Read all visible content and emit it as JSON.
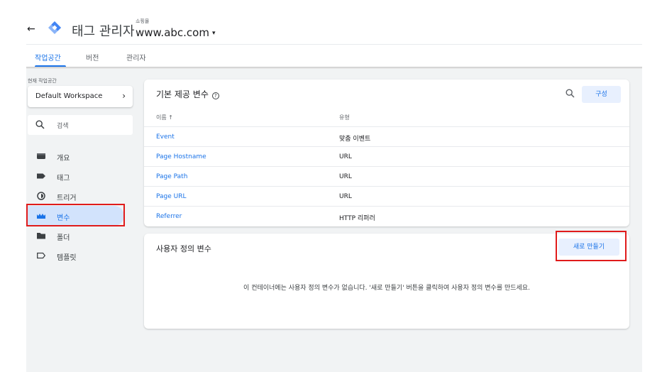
{
  "header": {
    "back_label": "←",
    "app_title": "태그 관리자",
    "account_label": "쇼핑몰",
    "container_name": "www.abc.com",
    "caret": "▾"
  },
  "tabs": [
    {
      "label": "작업공간",
      "active": true
    },
    {
      "label": "버전",
      "active": false
    },
    {
      "label": "관리자",
      "active": false
    }
  ],
  "sidebar": {
    "workspace_label": "현재 작업공간",
    "workspace_name": "Default Workspace",
    "workspace_chevron": "›",
    "search_placeholder": "검색",
    "items": [
      {
        "label": "개요",
        "icon": "overview-icon",
        "selected": false
      },
      {
        "label": "태그",
        "icon": "tag-icon",
        "selected": false
      },
      {
        "label": "트리거",
        "icon": "trigger-icon",
        "selected": false
      },
      {
        "label": "변수",
        "icon": "variable-icon",
        "selected": true
      },
      {
        "label": "폴더",
        "icon": "folder-icon",
        "selected": false
      },
      {
        "label": "템플릿",
        "icon": "template-icon",
        "selected": false
      }
    ]
  },
  "builtin": {
    "title": "기본 제공 변수",
    "help": "?",
    "config_label": "구성",
    "col_name": "이름 ↑",
    "col_type": "유형",
    "rows": [
      {
        "name": "Event",
        "type": "맞춤 이벤트"
      },
      {
        "name": "Page Hostname",
        "type": "URL"
      },
      {
        "name": "Page Path",
        "type": "URL"
      },
      {
        "name": "Page URL",
        "type": "URL"
      },
      {
        "name": "Referrer",
        "type": "HTTP 리퍼러"
      }
    ]
  },
  "user_defined": {
    "title": "사용자 정의 변수",
    "new_label": "새로 만들기",
    "empty_message": "이 컨테이너에는 사용자 정의 변수가 없습니다. '새로 만들기' 버튼을 클릭하여 사용자 정의 변수를 만드세요."
  },
  "colors": {
    "accent": "#1a73e8",
    "selected_bg": "#d2e3fc",
    "highlight_red": "#e01b1b",
    "button_bg": "#e8f0fe",
    "content_bg": "#f1f3f4"
  }
}
